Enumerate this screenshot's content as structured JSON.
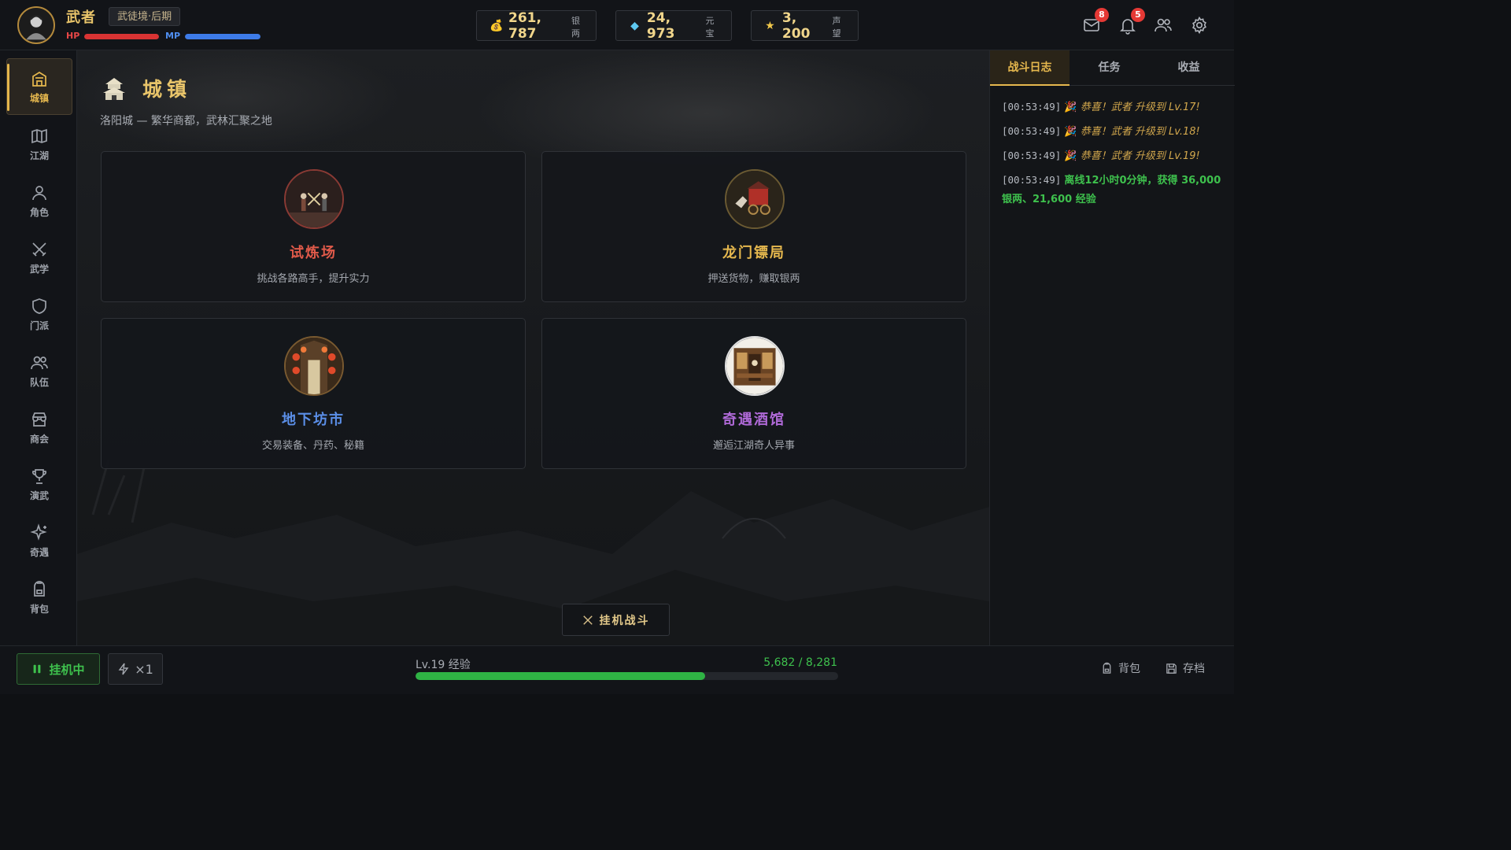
{
  "player": {
    "name": "武者",
    "realm": "武徒境·后期",
    "hp_label": "HP",
    "mp_label": "MP",
    "hp_fraction": 1.0,
    "mp_fraction": 1.0
  },
  "currencies": [
    {
      "value": "261, 787",
      "unit": "银两",
      "icon": "money-bag-icon"
    },
    {
      "value": "24, 973",
      "unit": "元宝",
      "icon": "diamond-icon"
    },
    {
      "value": "3, 200",
      "unit": "声望",
      "icon": "star-icon"
    }
  ],
  "top_icons": {
    "mail_badge": "8",
    "bell_badge": "5"
  },
  "sidebar": {
    "items": [
      {
        "label": "城镇",
        "icon": "castle-icon"
      },
      {
        "label": "江湖",
        "icon": "map-icon"
      },
      {
        "label": "角色",
        "icon": "user-icon"
      },
      {
        "label": "武学",
        "icon": "swords-icon"
      },
      {
        "label": "门派",
        "icon": "shield-icon"
      },
      {
        "label": "队伍",
        "icon": "users-icon"
      },
      {
        "label": "商会",
        "icon": "store-icon"
      },
      {
        "label": "演武",
        "icon": "trophy-icon"
      },
      {
        "label": "奇遇",
        "icon": "sparkles-icon"
      },
      {
        "label": "背包",
        "icon": "backpack-icon"
      }
    ],
    "active_index": 0
  },
  "main": {
    "title": "城镇",
    "subtitle": "洛阳城 — 繁华商都，武林汇聚之地",
    "cards": [
      {
        "title": "试炼场",
        "desc": "挑战各路高手，提升实力",
        "color": "#e05a4a"
      },
      {
        "title": "龙门镖局",
        "desc": "押送货物，赚取银两",
        "color": "#e6b84e"
      },
      {
        "title": "地下坊市",
        "desc": "交易装备、丹药、秘籍",
        "color": "#5b8fe8"
      },
      {
        "title": "奇遇酒馆",
        "desc": "邂逅江湖奇人异事",
        "color": "#b06ad8"
      }
    ],
    "auto_battle_label": "挂机战斗"
  },
  "right_panel": {
    "tabs": [
      "战斗日志",
      "任务",
      "收益"
    ],
    "active_tab": 0,
    "logs": [
      {
        "time": "[00:53:49]",
        "icon": "🎉",
        "msg": "恭喜！武者 升级到 Lv.17!",
        "kind": "level"
      },
      {
        "time": "[00:53:49]",
        "icon": "🎉",
        "msg": "恭喜！武者 升级到 Lv.18!",
        "kind": "level"
      },
      {
        "time": "[00:53:49]",
        "icon": "🎉",
        "msg": "恭喜！武者 升级到 Lv.19!",
        "kind": "level"
      },
      {
        "time": "[00:53:49]",
        "icon": "",
        "msg": "离线12小时0分钟，获得 36,000 银两、21,600 经验",
        "kind": "offline"
      }
    ]
  },
  "bottom": {
    "idle_label": "挂机中",
    "speed_label": "×1",
    "exp_label": "Lv.19 经验",
    "exp_value": "5,682 / 8,281",
    "exp_current": 5682,
    "exp_max": 8281,
    "bag_label": "背包",
    "save_label": "存档"
  },
  "colors": {
    "accent_gold": "#e6b84e",
    "hp_red": "#d93333",
    "mp_blue": "#3d7be8",
    "exp_green": "#2fb344"
  }
}
